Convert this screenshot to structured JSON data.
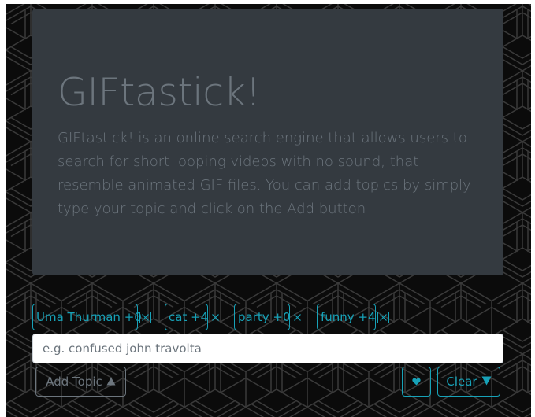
{
  "header": {
    "title": "GIFtastick!",
    "description": "GIFtastick! is an online search engine that allows users to search for short looping videos with no sound, that resemble animated GIF files. You can add topics by simply type your topic and click on the Add button"
  },
  "topics": [
    {
      "label": "Uma Thurman +0",
      "remove_icon": "close-box-icon"
    },
    {
      "label": "cat +4",
      "remove_icon": "close-box-icon"
    },
    {
      "label": "party +0",
      "remove_icon": "close-box-icon"
    },
    {
      "label": "funny +4",
      "remove_icon": "close-box-icon"
    }
  ],
  "search": {
    "placeholder": "e.g. confused john travolta",
    "value": ""
  },
  "actions": {
    "add_label": "Add Topic",
    "add_icon": "triangle-up-icon",
    "favorites_icon": "heart-icon",
    "clear_label": "Clear",
    "clear_icon": "triangle-down-icon"
  },
  "colors": {
    "accent": "#17a2b8",
    "muted": "#6c757d",
    "panel": "#343a40",
    "background": "#0b0b0b"
  }
}
